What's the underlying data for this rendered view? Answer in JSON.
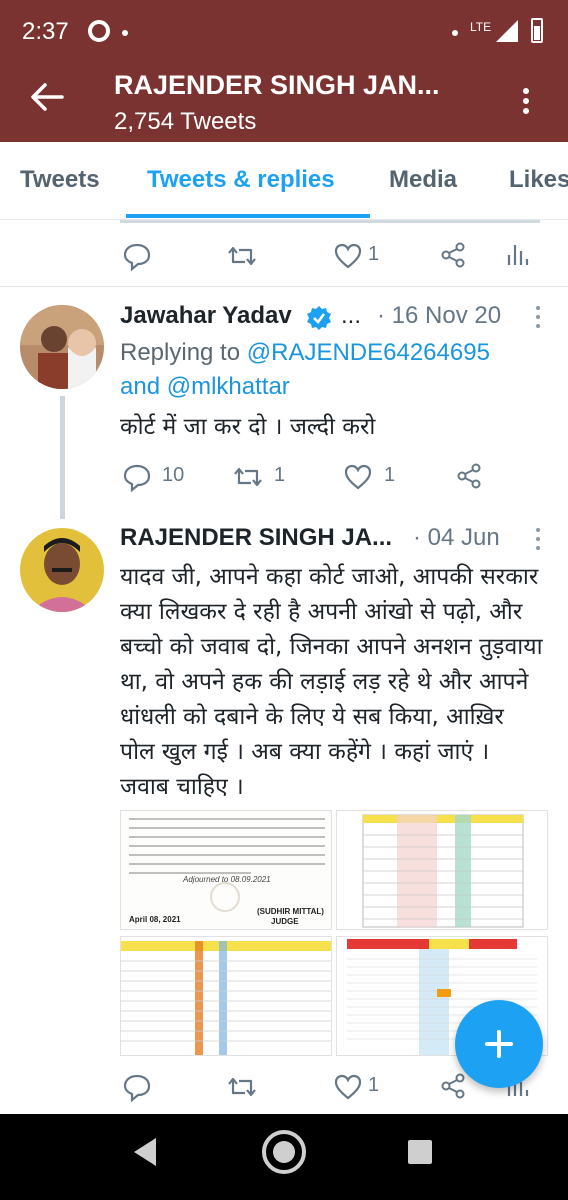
{
  "status_bar": {
    "time": "2:37",
    "network": "LTE"
  },
  "profile": {
    "name": "RAJENDER SINGH JAN...",
    "tweet_count": "2,754 Tweets"
  },
  "tabs": [
    {
      "label": "Tweets"
    },
    {
      "label": "Tweets & replies"
    },
    {
      "label": "Media"
    },
    {
      "label": "Likes"
    }
  ],
  "tweets": [
    {
      "likes": "1"
    },
    {
      "name": "Jawahar Yadav",
      "dots": "...",
      "date": "· 16 Nov 20",
      "replying_prefix": "Replying to",
      "mention1": "@RAJENDE64264695",
      "and_word": "and",
      "mention2": "@mlkhattar",
      "text": "कोर्ट में जा कर दो । जल्दी करो",
      "replies": "10",
      "retweets": "1",
      "likes": "1"
    },
    {
      "name": "RAJENDER SINGH JA...",
      "date": "· 04 Jun",
      "text": "यादव जी, आपने कहा कोर्ट जाओ, आपकी सरकार क्या लिखकर दे रही है अपनी आंखो से पढ़ो, और बच्चो को जवाब दो, जिनका आपने अनशन तुड़वाया था, वो अपने हक की लड़ाई लड़ रहे थे और आपने धांधली को दबाने के लिए ये सब किया, आख़िर पोल खुल गई । अब क्या कहेंगे । कहां जाएं । जवाब चाहिए ।",
      "likes": "1",
      "media_doc": {
        "dated": "April 08, 2021",
        "judge": "(SUDHIR MITTAL)",
        "judge_title": "JUDGE",
        "adjourned": "Adjourned to 08.09.2021"
      }
    }
  ],
  "colors": {
    "header": "#7b3331",
    "accent": "#1da1f2",
    "muted": "#657786"
  }
}
